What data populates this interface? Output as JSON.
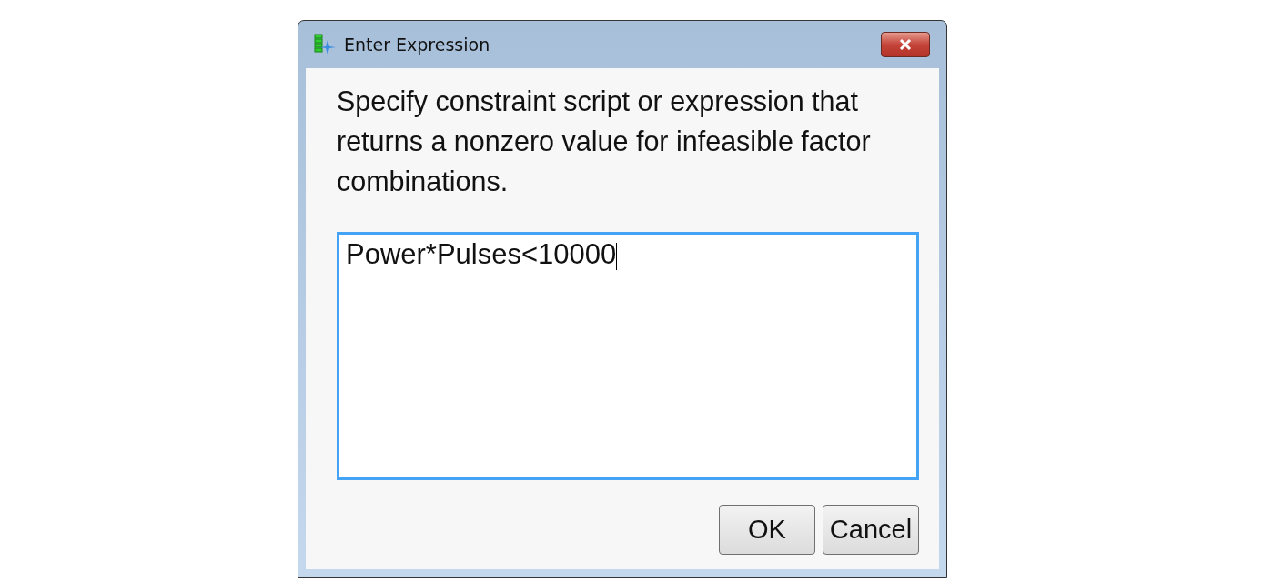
{
  "window": {
    "title": "Enter Expression"
  },
  "prompt": "Specify constraint script or expression that returns a nonzero value for infeasible factor combinations.",
  "expression": {
    "value": "Power*Pulses<10000",
    "focused": true
  },
  "buttons": [
    {
      "label": "OK"
    },
    {
      "label": "Cancel"
    }
  ]
}
